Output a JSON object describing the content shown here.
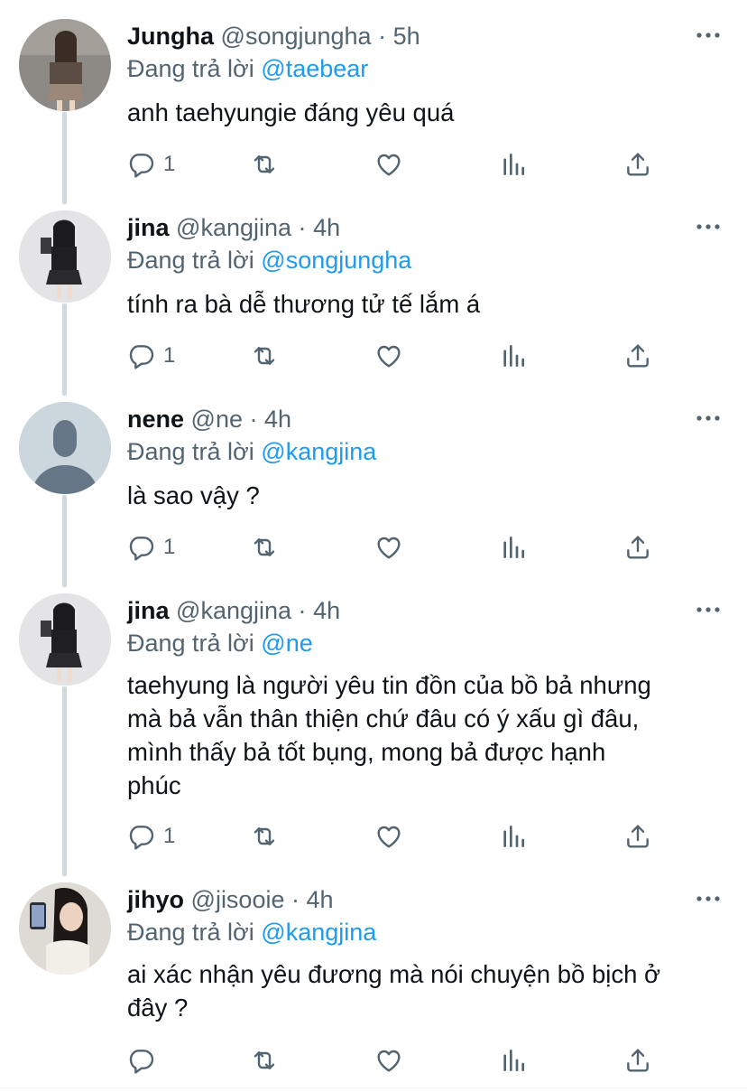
{
  "reply_prefix": "Đang trả lời",
  "tweets": [
    {
      "name": "Jungha",
      "handle": "@songjungha",
      "time": "5h",
      "reply_to": "@taebear",
      "text": "anh taehyungie đáng yêu quá",
      "reply_count": "1"
    },
    {
      "name": "jina",
      "handle": "@kangjina",
      "time": "4h",
      "reply_to": "@songjungha",
      "text": "tính ra bà dễ thương tử tế lắm á",
      "reply_count": "1"
    },
    {
      "name": "nene",
      "handle": "@ne",
      "time": "4h",
      "reply_to": "@kangjina",
      "text": "là sao vậy ?",
      "reply_count": "1"
    },
    {
      "name": "jina",
      "handle": "@kangjina",
      "time": "4h",
      "reply_to": "@ne",
      "text_lines": [
        "taehyung là người yêu tin đồn của bồ bả nhưng",
        "mà bả vẫn thân thiện chứ đâu có ý xấu gì đâu,",
        "mình thấy bả tốt bụng, mong bả được hạnh",
        "phúc"
      ],
      "reply_count": "1"
    },
    {
      "name": "jihyo",
      "handle": "@jisooie",
      "time": "4h",
      "reply_to": "@kangjina",
      "text_lines": [
        "ai xác nhận yêu đương mà nói chuyện bồ bịch ở",
        "đây ?"
      ],
      "reply_count": ""
    }
  ],
  "colors": {
    "accent": "#1d9bf0",
    "secondary_text": "#536471",
    "primary_text": "#0f1419",
    "thread_line": "#cfd9de"
  }
}
